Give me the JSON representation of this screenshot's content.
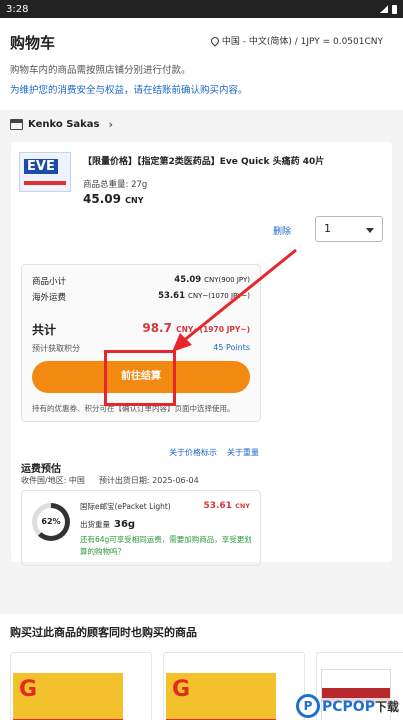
{
  "status_bar": {
    "time": "3:28"
  },
  "header": {
    "title": "购物车",
    "region": "中国 - 中文(简体) / 1JPY = 0.0501CNY",
    "description": "购物车内的商品需按照店铺分别进行付款。",
    "notice": "为维护您的消费安全与权益，请在结账前确认购买内容。"
  },
  "seller": {
    "name": "Kenko Sakas"
  },
  "product": {
    "name": "【限量价格】【指定第2类医药品】Eve Quick 头痛药 40片",
    "weight": "商品总重量: 27g",
    "price": "45.09",
    "currency": "CNY",
    "delete_label": "删除",
    "quantity": "1",
    "image_text": "EVE"
  },
  "summary": {
    "subtotal_label": "商品小计",
    "subtotal_value": "45.09",
    "subtotal_unit": "CNY(900 JPY)",
    "shipping_label": "海外运费",
    "shipping_value": "53.61",
    "shipping_unit": "CNY~(1070 JPY~)",
    "total_label": "共计",
    "total_value": "98.7",
    "total_unit": "CNY~(1970 JPY~)",
    "points_label": "预计获取积分",
    "points_value": "45 Points",
    "checkout_label": "前往结算",
    "coupon_note": "持有的优惠券、积分可在【确认订单内容】页面中选择使用。"
  },
  "links": {
    "price_note": "关于价格标示",
    "weight_note": "关于重量"
  },
  "shipping": {
    "title": "运费预估",
    "destination": "收件国/地区: 中国",
    "estimate_date": "预计出货日期: 2025-06-04",
    "progress_label": "62%",
    "progress": 0.62,
    "method": "国际e邮宝(ePacket Light)",
    "cost": "53.61",
    "cost_unit": "CNY",
    "weight_label": "出货重量",
    "weight_value": "36g",
    "tip": "还有64g可享受相同运费，需要加购商品，享受更划算的购物吗？"
  },
  "recommend": {
    "title": "购买过此商品的顾客同时也购买的商品"
  },
  "watermark": {
    "logo": "P",
    "text": "PCPOP",
    "suffix": "下载"
  },
  "colors": {
    "accent_orange": "#f28a12",
    "link_blue": "#1a66c8",
    "price_red": "#d43a3a",
    "tip_green": "#2a9a3a",
    "annotation_red": "#e8252a"
  }
}
